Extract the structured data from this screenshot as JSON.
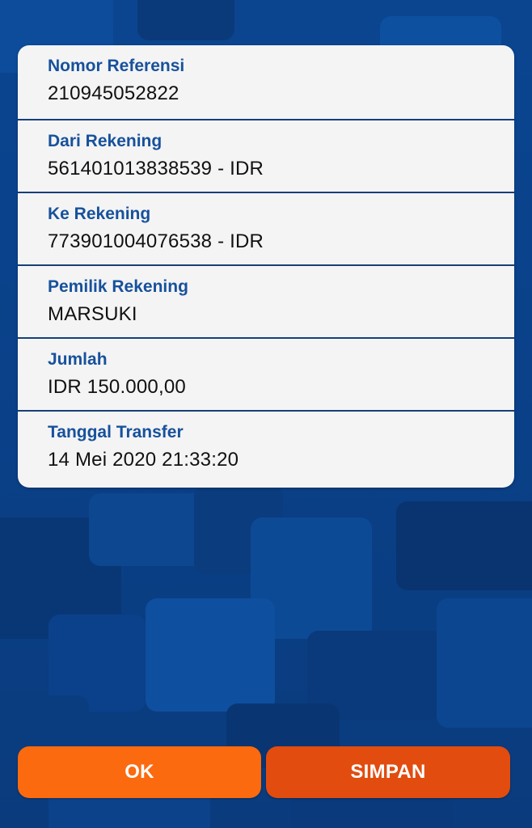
{
  "colors": {
    "label": "#17519b",
    "value": "#111111",
    "card_background": "#f4f4f5",
    "page_background": "#0a3f86",
    "ok_button": "#fb6a0e",
    "simpan_button": "#e24c0f"
  },
  "details": [
    {
      "label": "Nomor Referensi",
      "value": "210945052822"
    },
    {
      "label": "Dari Rekening",
      "value": "561401013838539 - IDR"
    },
    {
      "label": "Ke Rekening",
      "value": "773901004076538 - IDR"
    },
    {
      "label": "Pemilik Rekening",
      "value": "MARSUKI"
    },
    {
      "label": "Jumlah",
      "value": "IDR 150.000,00"
    },
    {
      "label": "Tanggal Transfer",
      "value": "14 Mei 2020 21:33:20"
    }
  ],
  "actions": {
    "ok_label": "OK",
    "simpan_label": "SIMPAN"
  }
}
